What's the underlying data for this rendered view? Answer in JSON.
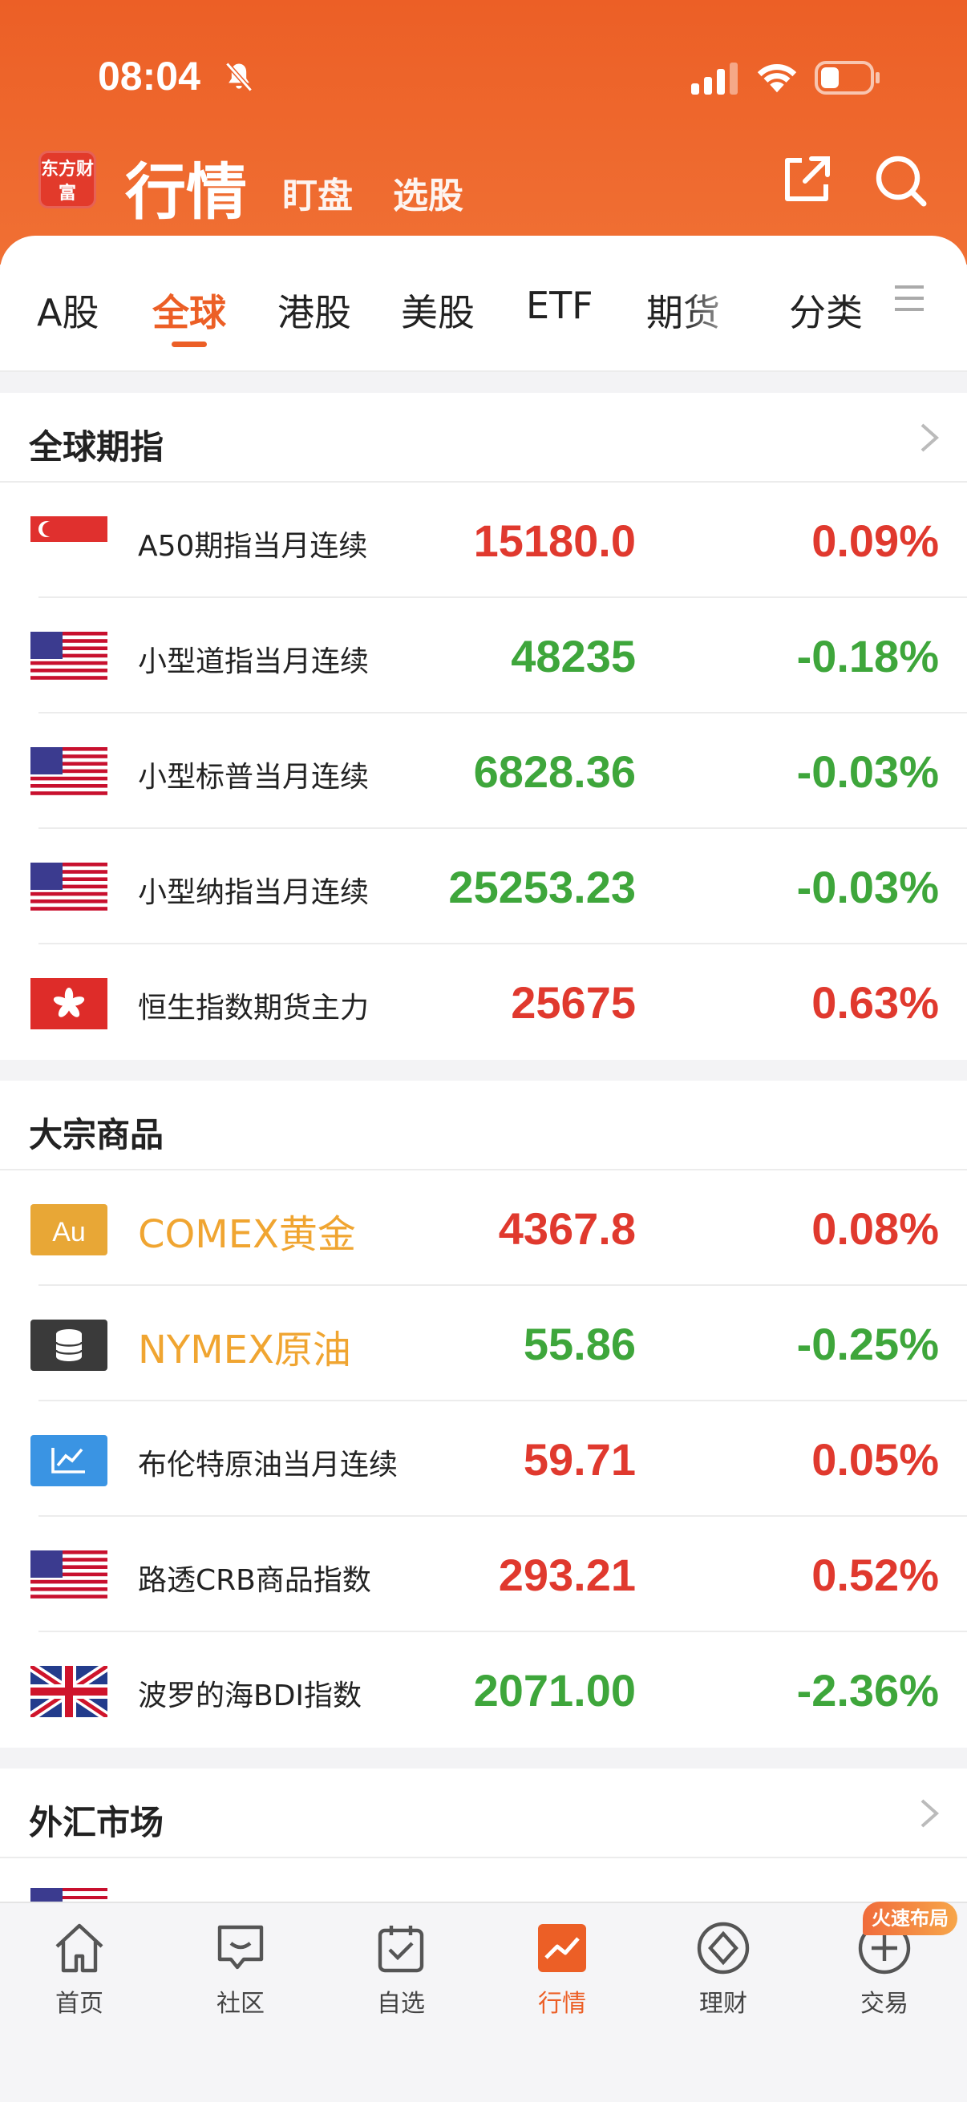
{
  "status": {
    "time": "08:04"
  },
  "header": {
    "logo_text": "东方财富",
    "title": "行情",
    "subnav": [
      "盯盘",
      "选股"
    ]
  },
  "tabs": [
    "A股",
    "全球",
    "港股",
    "美股",
    "ETF",
    "期货",
    "分类"
  ],
  "active_tab": "全球",
  "sections": [
    {
      "title": "全球期指",
      "rows": [
        {
          "name": "A50期指当月连续",
          "price": "15180.0",
          "pct": "0.09%",
          "dir": "up",
          "flag": "sg"
        },
        {
          "name": "小型道指当月连续",
          "price": "48235",
          "pct": "-0.18%",
          "dir": "down",
          "flag": "us"
        },
        {
          "name": "小型标普当月连续",
          "price": "6828.36",
          "pct": "-0.03%",
          "dir": "down",
          "flag": "us"
        },
        {
          "name": "小型纳指当月连续",
          "price": "25253.23",
          "pct": "-0.03%",
          "dir": "down",
          "flag": "us"
        },
        {
          "name": "恒生指数期货主力",
          "price": "25675",
          "pct": "0.63%",
          "dir": "up",
          "flag": "hk"
        }
      ]
    },
    {
      "title": "大宗商品",
      "rows": [
        {
          "name": "COMEX黄金",
          "price": "4367.8",
          "pct": "0.08%",
          "dir": "up",
          "flag": "au"
        },
        {
          "name": "NYMEX原油",
          "price": "55.86",
          "pct": "-0.25%",
          "dir": "down",
          "flag": "oil"
        },
        {
          "name": "布伦特原油当月连续",
          "price": "59.71",
          "pct": "0.05%",
          "dir": "up",
          "flag": "chart"
        },
        {
          "name": "路透CRB商品指数",
          "price": "293.21",
          "pct": "0.52%",
          "dir": "up",
          "flag": "us"
        },
        {
          "name": "波罗的海BDI指数",
          "price": "2071.00",
          "pct": "-2.36%",
          "dir": "down",
          "flag": "uk"
        }
      ]
    },
    {
      "title": "外汇市场",
      "rows": []
    }
  ],
  "bottom_nav": [
    "首页",
    "社区",
    "自选",
    "行情",
    "理财",
    "交易"
  ],
  "promo_badge": "火速布局",
  "colors": {
    "accent": "#ec5f26",
    "up": "#e0392e",
    "down": "#3ea63b",
    "gold": "#f0a531"
  }
}
